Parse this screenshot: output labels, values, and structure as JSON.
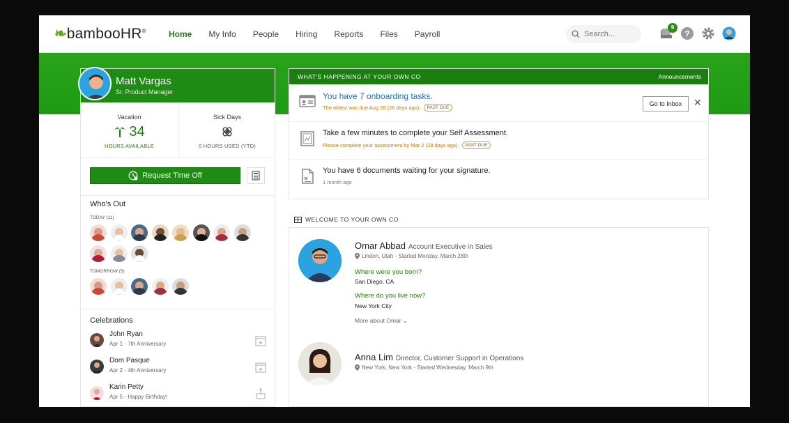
{
  "nav": {
    "logo": "bambooHR",
    "logo_mark": "®",
    "items": [
      {
        "label": "Home",
        "active": true
      },
      {
        "label": "My Info"
      },
      {
        "label": "People"
      },
      {
        "label": "Hiring"
      },
      {
        "label": "Reports"
      },
      {
        "label": "Files"
      },
      {
        "label": "Payroll"
      }
    ],
    "search_placeholder": "Search...",
    "inbox_badge": "9",
    "icons": [
      "search-icon",
      "inbox-icon",
      "help-icon",
      "gear-icon",
      "avatar"
    ]
  },
  "colors": {
    "brand_green": "#1e8c12",
    "accent_blue": "#1a73b8",
    "past_due": "#c57a00"
  },
  "profile": {
    "name": "Matt Vargas",
    "title": "Sr. Product Manager",
    "vacation": {
      "label": "Vacation",
      "value": "34",
      "sub": "HOURS AVAILABLE"
    },
    "sick": {
      "label": "Sick Days",
      "sub": "0 HOURS USED (YTD)"
    },
    "request_btn": "Request Time Off"
  },
  "whos_out": {
    "title": "Who's Out",
    "today_label": "TODAY (11)",
    "tomorrow_label": "TOMORROW (5)"
  },
  "celebrations": {
    "title": "Celebrations",
    "items": [
      {
        "name": "John Ryan",
        "sub": "Apr 1 - 7th Anniversary"
      },
      {
        "name": "Dom Pasque",
        "sub": "Apr 2 - 4th Anniversary"
      },
      {
        "name": "Karin Petty",
        "sub": "Apr 5 - Happy Birthday!"
      }
    ]
  },
  "happening": {
    "title": "WHAT'S HAPPENING AT YOUR OWN CO",
    "link": "Announcements",
    "tasks": [
      {
        "main": "You have 7 onboarding tasks.",
        "sub": "The oldest was due Aug 26 (26 days ago).",
        "pill": "PAST DUE"
      },
      {
        "main": "Take a few minutes to complete your Self Assessment.",
        "sub": "Please complete your assessment by Mar 2 (28 days ago).",
        "pill": "PAST DUE"
      },
      {
        "main": "You have 6 documents waiting for your signature.",
        "sub": "1 month ago"
      }
    ],
    "inbox_btn": "Go to Inbox",
    "close": "✕"
  },
  "welcome": {
    "title": "WELCOME TO YOUR OWN CO",
    "people": [
      {
        "name": "Omar Abbad",
        "role": "Account Executive in Sales",
        "loc": "Lindon, Utah - Started Monday, March 28th",
        "q1": "Where were you born?",
        "a1": "San Diego, CA",
        "q2": "Where do you live now?",
        "a2": "New York City",
        "more": "More about Omar"
      },
      {
        "name": "Anna Lim",
        "role": "Director, Customer Support in Operations",
        "loc": "New York, New York - Started Wednesday, March 9th"
      }
    ]
  }
}
